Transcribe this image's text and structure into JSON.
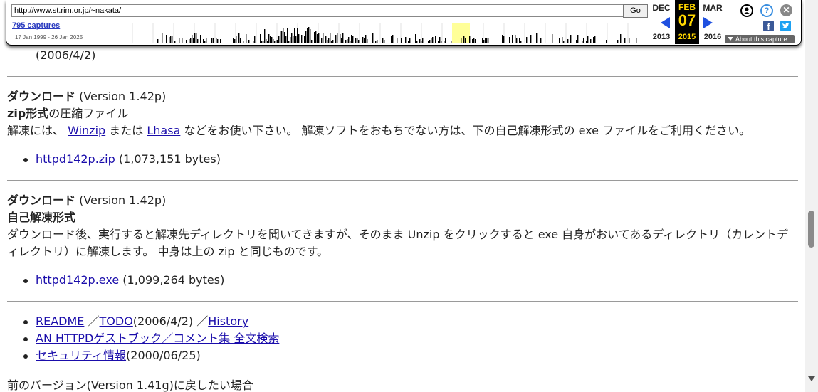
{
  "wayback": {
    "url": "http://www.st.rim.or.jp/~nakata/",
    "go_label": "Go",
    "captures_label": "795 captures",
    "date_range": "17 Jan 1999 - 26 Jan 2025",
    "prev_month": "DEC",
    "prev_year": "2013",
    "current_month": "FEB",
    "current_day": "07",
    "current_year": "2015",
    "next_month": "MAR",
    "next_year": "2016",
    "about_label": "About this capture",
    "icons": [
      "user-icon",
      "help-icon",
      "close-icon",
      "facebook-icon",
      "twitter-icon"
    ],
    "accent_color": "#1f50e0",
    "highlight_color": "#ffd700"
  },
  "content": {
    "top_fragment": "(2006/4/2)",
    "ghost_text": "42p",
    "section1": {
      "heading": "ダウンロード",
      "version": "(Version 1.42p)",
      "format_bold": "zip形式",
      "format_rest": "の圧縮ファイル",
      "desc_prefix": "解凍には、",
      "link1": "Winzip",
      "desc_mid": "または",
      "link2": "Lhasa",
      "desc_suffix": "などをお使い下さい。 解凍ソフトをおもちでない方は、下の自己解凍形式の exe ファイルをご利用ください。",
      "file_link": "httpd142p.zip",
      "file_size": "(1,073,151 bytes)"
    },
    "section2": {
      "heading": "ダウンロード",
      "version": "(Version 1.42p)",
      "format_bold": "自己解凍形式",
      "desc_line1": "ダウンロード後、実行すると解凍先ディレクトリを聞いてきますが、そのまま Unzip をクリックすると exe 自身がおいてあるディレクトリ（カレントデ",
      "desc_line2": "ィレクトリ）に解凍します。 中身は上の zip と同じものです。",
      "file_link": "httpd142p.exe",
      "file_size": "(1,099,264 bytes)"
    },
    "links": {
      "readme": "README",
      "sep1": "／",
      "todo": "TODO",
      "todo_date": "(2006/4/2) ／",
      "history": "History",
      "guestbook": "AN HTTPDゲストブック／コメント集 全文検索",
      "security": "セキュリティ情報",
      "security_date": "(2000/06/25)"
    },
    "bottom_fragment": "前のバージョン(Version 1.41g)に戻したい場合"
  }
}
